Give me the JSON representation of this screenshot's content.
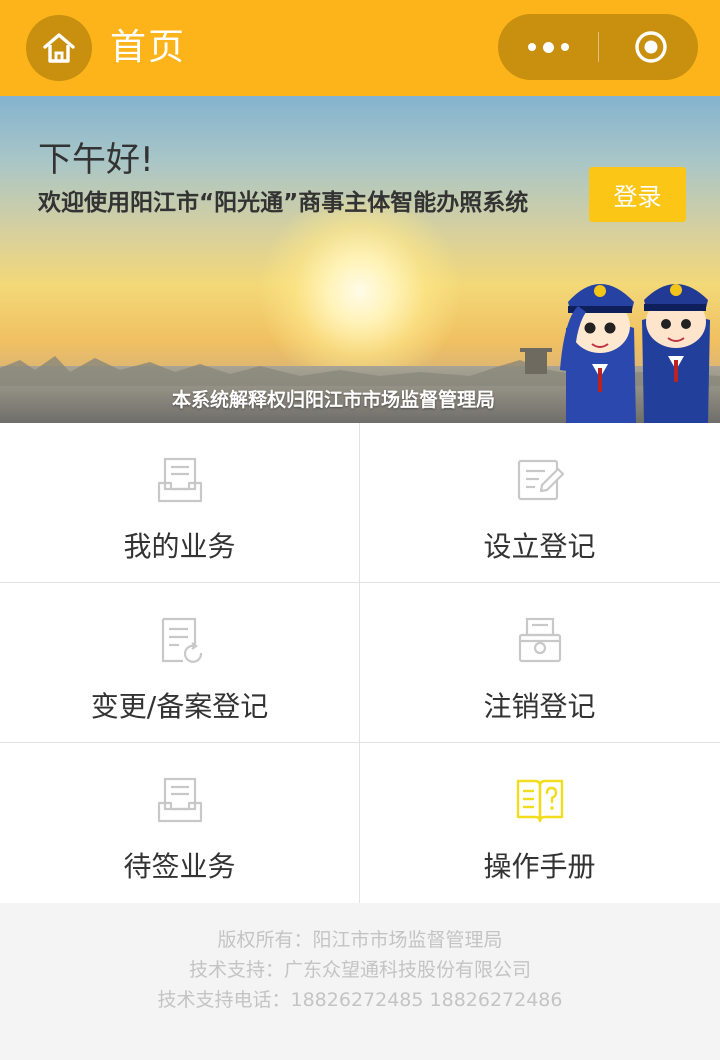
{
  "navbar": {
    "title": "首页",
    "home_icon": "home-icon",
    "more_icon": "more-dots-icon",
    "close_icon": "target-circle-icon",
    "bg_color": "#fcb41a"
  },
  "banner": {
    "greeting": "下午好!",
    "welcome": "欢迎使用阳江市“阳光通”商事主体智能办照系统",
    "login_label": "登录",
    "footer_note": "本系统解释权归阳江市市场监督管理局"
  },
  "menu": {
    "items": [
      {
        "label": "我的业务",
        "icon": "document-tray-icon"
      },
      {
        "label": "设立登记",
        "icon": "edit-document-icon"
      },
      {
        "label": "变更/备案登记",
        "icon": "document-refresh-icon"
      },
      {
        "label": "注销登记",
        "icon": "printer-icon"
      },
      {
        "label": "待签业务",
        "icon": "document-tray-icon"
      },
      {
        "label": "操作手册",
        "icon": "help-book-icon"
      }
    ]
  },
  "footer": {
    "copyright": "版权所有：阳江市市场监督管理局",
    "support": "技术支持：广东众望通科技股份有限公司",
    "phone": "技术支持电话：18826272485 18826272486"
  },
  "colors": {
    "accent": "#fcb41a",
    "login_button": "#fcc617",
    "icon_gray": "#c8c8c8",
    "icon_yellow": "#f2dc1e"
  }
}
